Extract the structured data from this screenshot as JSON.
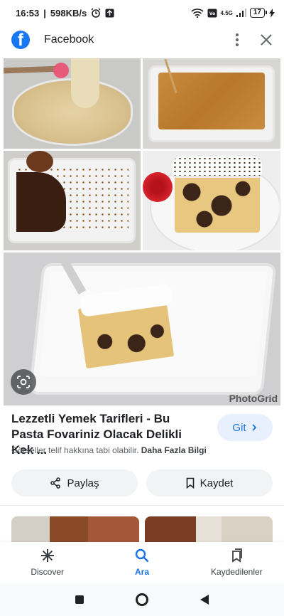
{
  "status_bar": {
    "time": "16:53",
    "network_speed": "598KB/s",
    "signal_label": "4.5G",
    "battery": "17"
  },
  "header": {
    "app_title": "Facebook",
    "logo_letter": "f"
  },
  "image": {
    "watermark": "PhotoGrid"
  },
  "result": {
    "title": "Lezzetli Yemek Tarifleri - Bu Pasta Fovariniz Olacak Delikli Kek ...",
    "visit_label": "Git",
    "copyright_text": "Görseller telif hakkına tabi olabilir.",
    "more_info": "Daha Fazla Bilgi"
  },
  "actions": {
    "share_label": "Paylaş",
    "save_label": "Kaydet"
  },
  "bottom_nav": {
    "items": [
      {
        "label": "Discover",
        "icon": "asterisk-icon"
      },
      {
        "label": "Ara",
        "icon": "search-icon",
        "active": true
      },
      {
        "label": "Kaydedilenler",
        "icon": "collections-icon"
      }
    ]
  },
  "colors": {
    "accent": "#1a73e8",
    "facebook": "#1877f2",
    "pill_bg": "#f1f3f4",
    "git_bg": "#e8f0fe"
  }
}
